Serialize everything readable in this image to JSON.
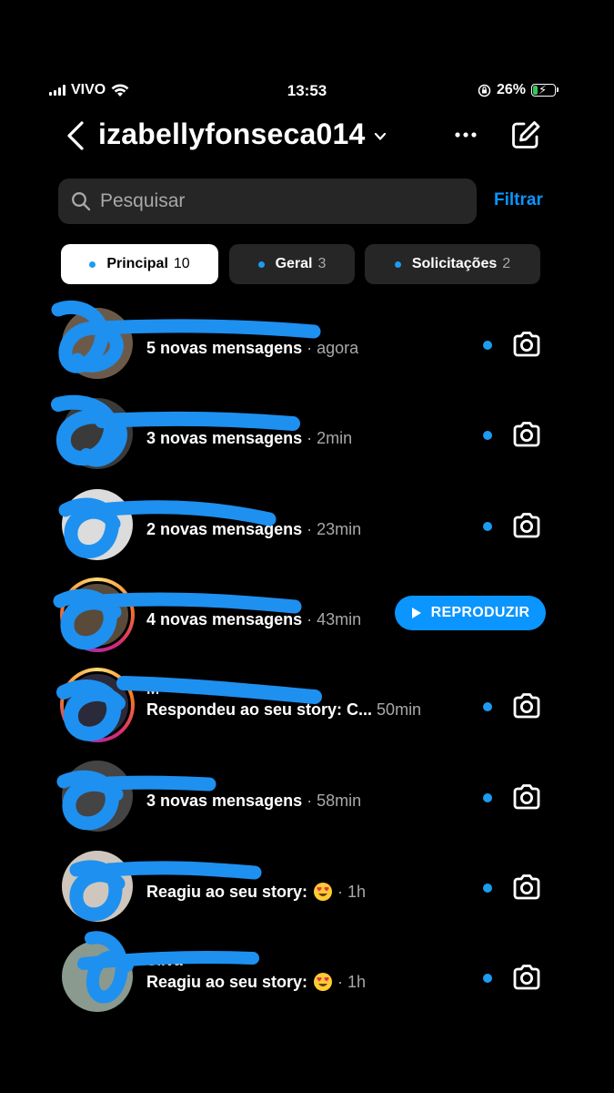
{
  "status_bar": {
    "carrier": "VIVO",
    "time": "13:53",
    "battery_percent": "26%",
    "battery_level": 0.26,
    "icons": [
      "signal-icon",
      "wifi-icon",
      "orientation-lock-icon",
      "battery-charging-icon"
    ]
  },
  "header": {
    "username": "izabellyfonseca014"
  },
  "search": {
    "placeholder": "Pesquisar",
    "value": "",
    "filter_label": "Filtrar"
  },
  "tabs": [
    {
      "label": "Principal",
      "count": "10",
      "active": true
    },
    {
      "label": "Geral",
      "count": "3",
      "active": false
    },
    {
      "label": "Solicitações",
      "count": "2",
      "active": false
    }
  ],
  "conversations": [
    {
      "name": "",
      "message": "5 novas mensagens",
      "time": "· agora",
      "unread": true,
      "action": "camera",
      "avatar_ring": false,
      "avatar_color": "#6b5a4a"
    },
    {
      "name": "",
      "message": "3 novas mensagens",
      "time": "· 2min",
      "unread": true,
      "action": "camera",
      "avatar_ring": false,
      "avatar_color": "#3a3a3a"
    },
    {
      "name": "",
      "message": "2 novas mensagens",
      "time": "· 23min",
      "unread": true,
      "action": "camera",
      "avatar_ring": false,
      "avatar_color": "#dcdcdc"
    },
    {
      "name": "",
      "message": "4 novas mensagens",
      "time": "· 43min",
      "unread": false,
      "action": "play",
      "action_label": "REPRODUZIR",
      "avatar_ring": true,
      "avatar_color": "#5a4a3a"
    },
    {
      "name": "M",
      "message": "Respondeu ao seu story: C...",
      "time": "50min",
      "unread": true,
      "action": "camera",
      "avatar_ring": true,
      "avatar_color": "#2a2a3a"
    },
    {
      "name": "",
      "message": "3 novas mensagens",
      "time": "· 58min",
      "unread": true,
      "action": "camera",
      "avatar_ring": false,
      "avatar_color": "#444444"
    },
    {
      "name": "",
      "message": "Reagiu ao seu story:",
      "emoji": "heart-eyes",
      "time": "· 1h",
      "unread": true,
      "action": "camera",
      "avatar_ring": false,
      "avatar_color": "#cfc7bd"
    },
    {
      "name": "Silva",
      "message": "Reagiu ao seu story:",
      "emoji": "heart-eyes",
      "time": "· 1h",
      "unread": true,
      "action": "camera",
      "avatar_ring": false,
      "avatar_color": "#8a9a8f"
    }
  ],
  "colors": {
    "accent": "#0a95ff",
    "unread_dot": "#1d9bf0",
    "scribble": "#1e90f0",
    "background": "#000000",
    "surface": "#262626"
  }
}
